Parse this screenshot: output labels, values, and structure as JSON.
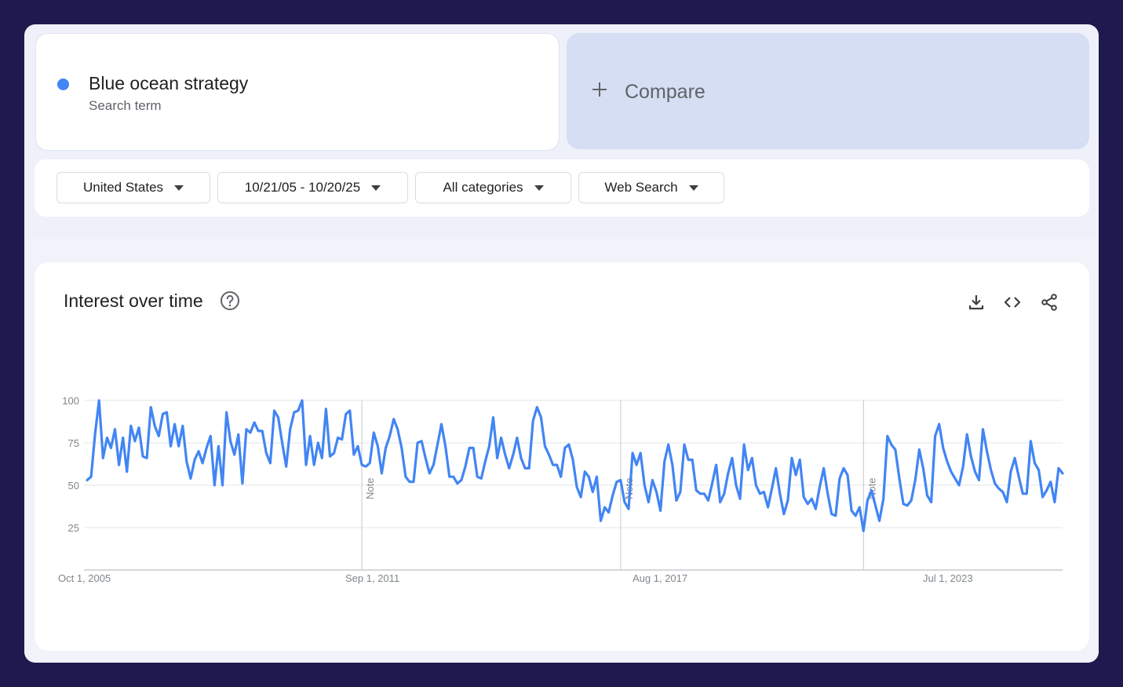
{
  "search_term": {
    "name": "Blue ocean strategy",
    "type": "Search term",
    "color": "#4285f4"
  },
  "compare": {
    "label": "Compare"
  },
  "filters": {
    "region": "United States",
    "date_range": "10/21/05 - 10/20/25",
    "category": "All categories",
    "search_type": "Web Search"
  },
  "chart": {
    "title": "Interest over time",
    "icons": [
      "help-icon",
      "download-icon",
      "embed-icon",
      "share-icon"
    ]
  },
  "chart_data": {
    "type": "line",
    "ylim": [
      0,
      100
    ],
    "y_ticks": [
      "100",
      "75",
      "50",
      "25"
    ],
    "x_tick_labels": [
      "Oct 1, 2005",
      "Sep 1, 2011",
      "Aug 1, 2017",
      "Jul 1, 2023"
    ],
    "notes": [
      {
        "date": "2011-07",
        "label": "Note"
      },
      {
        "date": "2016-12",
        "label": "Note"
      },
      {
        "date": "2022-01",
        "label": "Note"
      }
    ],
    "grid": true,
    "series": [
      {
        "color": "#4285f4",
        "x_start": "2005-10",
        "x_step": "1 month",
        "values": [
          53,
          55,
          80,
          100,
          66,
          78,
          72,
          83,
          62,
          78,
          58,
          85,
          76,
          84,
          67,
          66,
          96,
          85,
          79,
          92,
          93,
          73,
          86,
          73,
          85,
          64,
          54,
          65,
          70,
          63,
          72,
          79,
          50,
          73,
          50,
          93,
          76,
          68,
          80,
          51,
          83,
          81,
          87,
          82,
          82,
          69,
          63,
          94,
          90,
          75,
          61,
          83,
          93,
          94,
          100,
          62,
          79,
          62,
          75,
          66,
          95,
          67,
          69,
          78,
          77,
          92,
          94,
          68,
          73,
          62,
          61,
          63,
          81,
          73,
          57,
          72,
          79,
          89,
          83,
          72,
          55,
          52,
          52,
          75,
          76,
          66,
          57,
          62,
          74,
          86,
          73,
          55,
          55,
          51,
          53,
          61,
          72,
          72,
          55,
          54,
          64,
          73,
          90,
          66,
          78,
          68,
          60,
          68,
          78,
          66,
          60,
          60,
          88,
          96,
          90,
          73,
          68,
          62,
          62,
          55,
          72,
          74,
          65,
          49,
          43,
          58,
          55,
          46,
          55,
          29,
          37,
          34,
          44,
          52,
          53,
          40,
          36,
          69,
          62,
          69,
          50,
          40,
          53,
          46,
          35,
          64,
          74,
          62,
          41,
          46,
          74,
          65,
          65,
          47,
          45,
          45,
          41,
          51,
          62,
          40,
          45,
          57,
          66,
          50,
          42,
          74,
          59,
          66,
          50,
          45,
          46,
          37,
          48,
          60,
          45,
          33,
          41,
          66,
          56,
          65,
          43,
          39,
          42,
          36,
          49,
          60,
          45,
          33,
          32,
          54,
          60,
          56,
          35,
          32,
          37,
          23,
          41,
          47,
          38,
          29,
          42,
          79,
          74,
          71,
          54,
          39,
          38,
          41,
          53,
          71,
          60,
          44,
          40,
          79,
          86,
          72,
          64,
          58,
          54,
          50,
          61,
          80,
          67,
          58,
          53,
          83,
          70,
          59,
          51,
          48,
          46,
          40,
          58,
          66,
          55,
          45,
          45,
          76,
          63,
          59,
          43,
          47,
          52,
          40,
          60,
          57
        ]
      }
    ]
  }
}
